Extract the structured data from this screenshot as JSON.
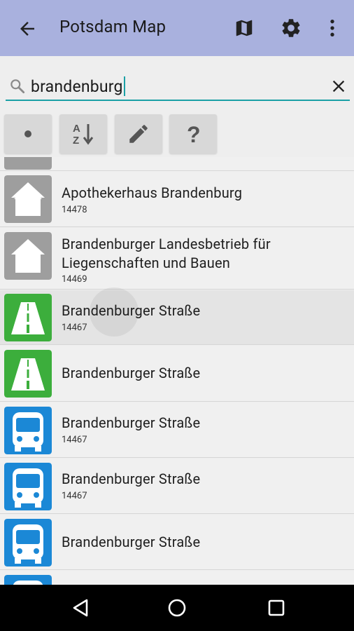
{
  "appbar": {
    "title": "Potsdam Map",
    "background": "#a9b1de",
    "icons": [
      "back-arrow-icon",
      "map-icon",
      "gear-icon",
      "overflow-menu-icon"
    ]
  },
  "search": {
    "value": "brandenburg",
    "accent": "#1ba0a6"
  },
  "filters": [
    {
      "icon": "dot-icon"
    },
    {
      "icon": "sort-az-icon"
    },
    {
      "icon": "pencil-icon"
    },
    {
      "icon": "help-icon"
    }
  ],
  "results": [
    {
      "title": "Apothekerhaus Brandenburg",
      "code": "14478",
      "icon": "house-icon"
    },
    {
      "title": "Brandenburger Landesbetrieb für\nLiegenschaften und Bauen",
      "code": "14469",
      "icon": "house-icon"
    },
    {
      "title": "Brandenburger Straße",
      "code": "14467",
      "icon": "road-icon"
    },
    {
      "title": "Brandenburger Straße",
      "code": "",
      "icon": "road-icon"
    },
    {
      "title": "Brandenburger Straße",
      "code": "14467",
      "icon": "bus-icon"
    },
    {
      "title": "Brandenburger Straße",
      "code": "14467",
      "icon": "bus-icon"
    },
    {
      "title": "Brandenburger Straße",
      "code": "",
      "icon": "bus-icon"
    }
  ],
  "colors": {
    "house": "#9e9e9e",
    "road": "#3cae3c",
    "bus": "#1b88d6"
  },
  "navbar": {
    "icons": [
      "back-triangle-icon",
      "home-circle-icon",
      "recents-square-icon"
    ]
  }
}
